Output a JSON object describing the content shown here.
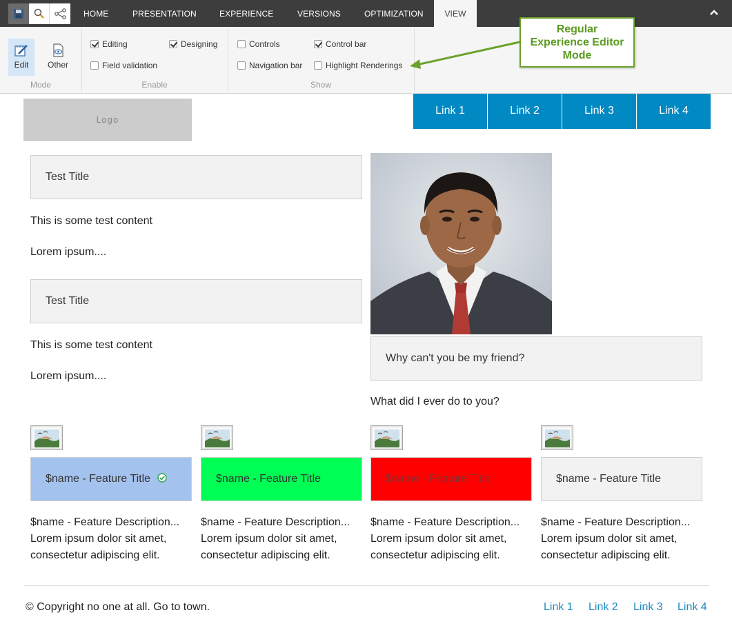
{
  "ribbon": {
    "tabs": [
      "HOME",
      "PRESENTATION",
      "EXPERIENCE",
      "VERSIONS",
      "OPTIMIZATION",
      "VIEW"
    ],
    "active_tab": "VIEW",
    "mode": {
      "edit_label": "Edit",
      "other_label": "Other",
      "group_label": "Mode"
    },
    "enable": {
      "group_label": "Enable",
      "editing": {
        "label": "Editing",
        "checked": true
      },
      "designing": {
        "label": "Designing",
        "checked": true
      },
      "field_validation": {
        "label": "Field validation",
        "checked": false
      }
    },
    "show": {
      "group_label": "Show",
      "controls": {
        "label": "Controls",
        "checked": false
      },
      "control_bar": {
        "label": "Control bar",
        "checked": true
      },
      "navigation_bar": {
        "label": "Navigation bar",
        "checked": false
      },
      "highlight_renderings": {
        "label": "Highlight Renderings",
        "checked": false
      }
    }
  },
  "annotation": {
    "line1": "Regular",
    "line2": "Experience Editor",
    "line3": "Mode",
    "color": "#5a9a1f"
  },
  "header": {
    "logo": "Logo",
    "nav": [
      "Link 1",
      "Link 2",
      "Link 3",
      "Link 4"
    ],
    "nav_color": "#0089c3"
  },
  "content": {
    "blocks": [
      {
        "title": "Test Title",
        "text": "This is some test content",
        "more": "Lorem ipsum...."
      },
      {
        "title": "Test Title",
        "text": "This is some test content",
        "more": "Lorem ipsum...."
      }
    ],
    "quote_title": "Why can't you be my friend?",
    "quote_text": "What did I ever do to you?"
  },
  "features": [
    {
      "title": "$name - Feature Title",
      "bg": "#a4c2ee",
      "color": "#333333",
      "desc1": "$name - Feature Description...",
      "desc2": "Lorem ipsum dolor sit amet,",
      "desc3": "consectetur adipiscing elit."
    },
    {
      "title": "$name - Feature Title",
      "bg": "#00ff55",
      "color": "#333333",
      "desc1": "$name - Feature Description...",
      "desc2": "Lorem ipsum dolor sit amet,",
      "desc3": "consectetur adipiscing elit."
    },
    {
      "title": "$name - Feature Title",
      "bg": "#ff0000",
      "color": "#8a2d2d",
      "desc1": "$name - Feature Description...",
      "desc2": "Lorem ipsum dolor sit amet,",
      "desc3": "consectetur adipiscing elit."
    },
    {
      "title": "$name - Feature Title",
      "bg": "#f2f2f2",
      "color": "#333333",
      "desc1": "$name - Feature Description...",
      "desc2": "Lorem ipsum dolor sit amet,",
      "desc3": "consectetur adipiscing elit."
    }
  ],
  "footer": {
    "copyright": "© Copyright no one at all. Go to town.",
    "links": [
      "Link 1",
      "Link 2",
      "Link 3",
      "Link 4"
    ]
  }
}
